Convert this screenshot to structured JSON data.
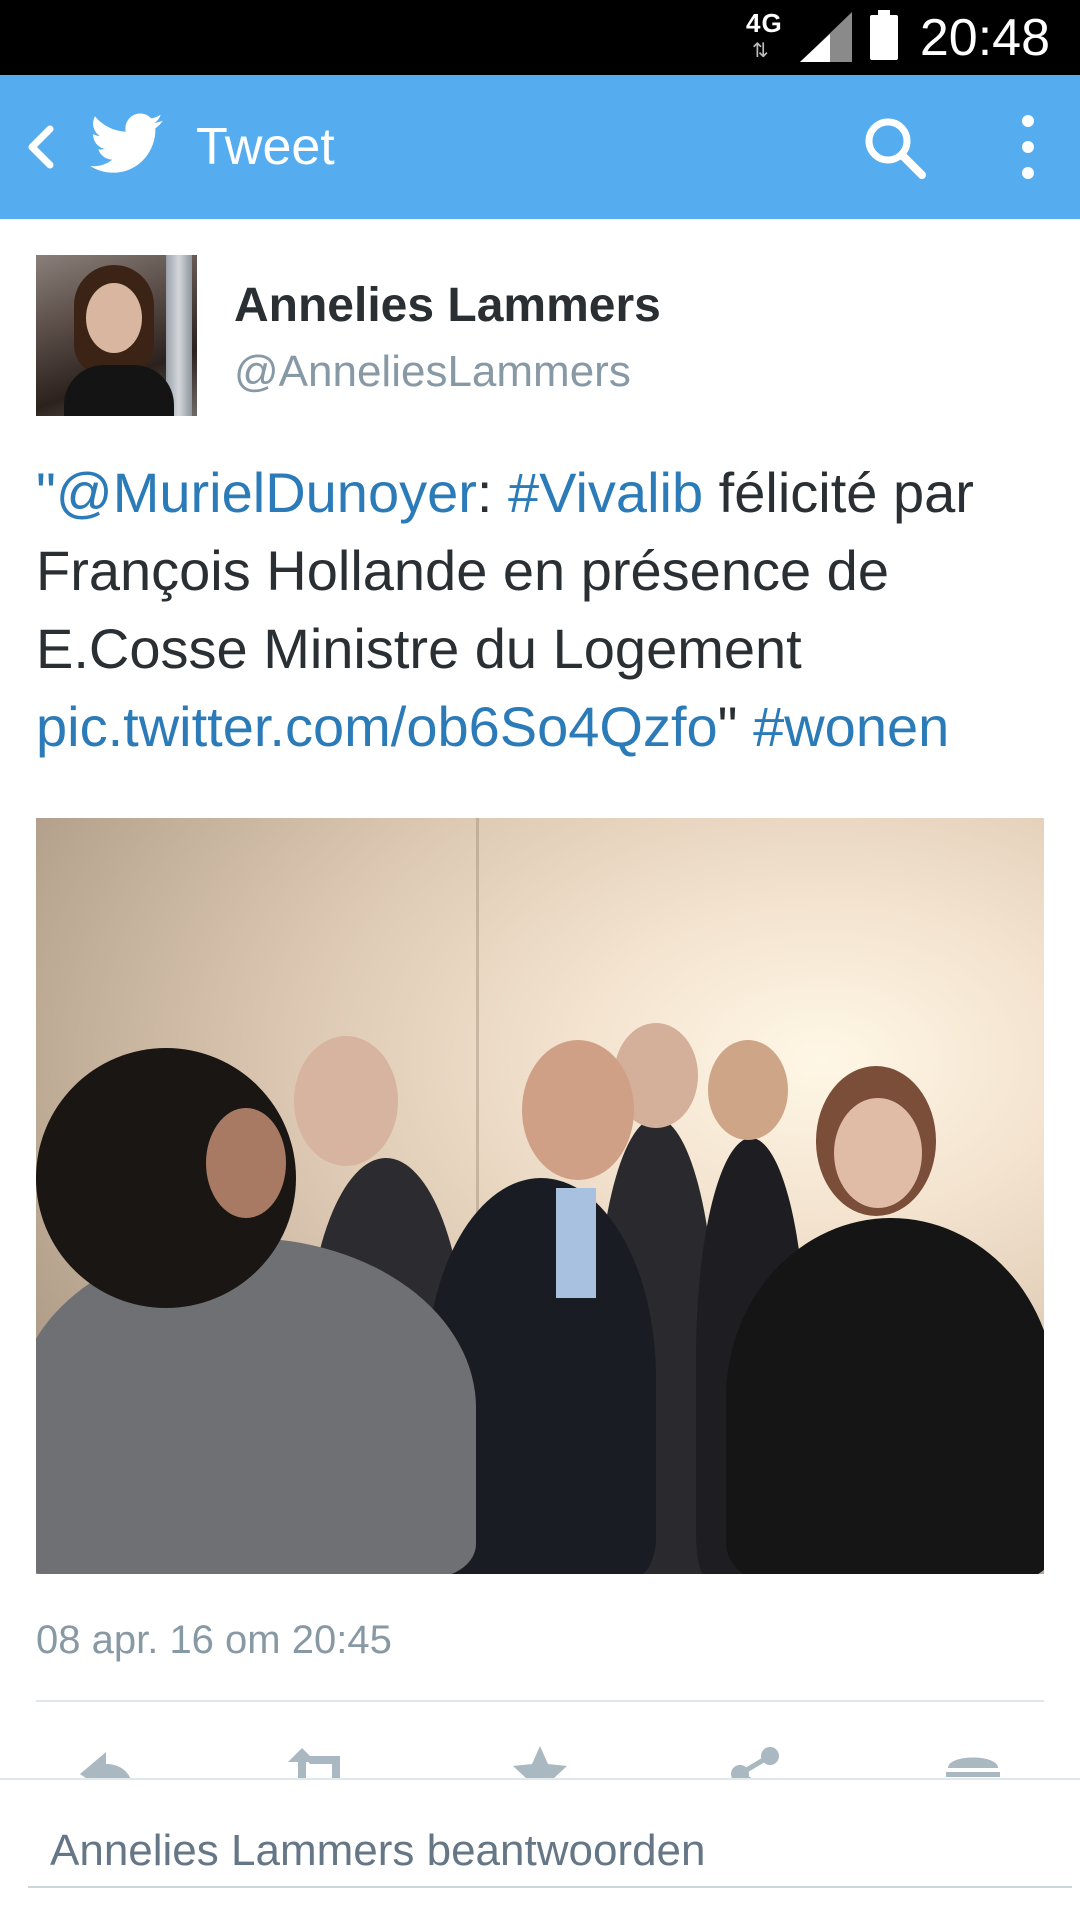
{
  "status_bar": {
    "network": "4G",
    "time": "20:48"
  },
  "app_bar": {
    "title": "Tweet",
    "icons": [
      "back-icon",
      "twitter-bird-icon",
      "search-icon",
      "more-vert-icon"
    ],
    "color": "#55acee"
  },
  "tweet": {
    "author_name": "Annelies Lammers",
    "author_handle": "@AnneliesLammers",
    "text": {
      "quote_open": "\"",
      "mention": "@MurielDunoyer",
      "colon": ": ",
      "hashtag1": "#Vivalib",
      "body": " félicité par François Hollande en présence de E.Cosse Ministre du Logement ",
      "pic_link": "pic.twitter.com/ob6So4Qzfo",
      "quote_close": "\" ",
      "hashtag2": "#wonen"
    },
    "timestamp": "08 apr. 16 om 20:45",
    "link_color": "#2b7bb9"
  },
  "actions": [
    "reply-icon",
    "retweet-icon",
    "favorite-icon",
    "share-icon",
    "more-actions-icon"
  ],
  "reply": {
    "placeholder": "Annelies Lammers beantwoorden"
  }
}
